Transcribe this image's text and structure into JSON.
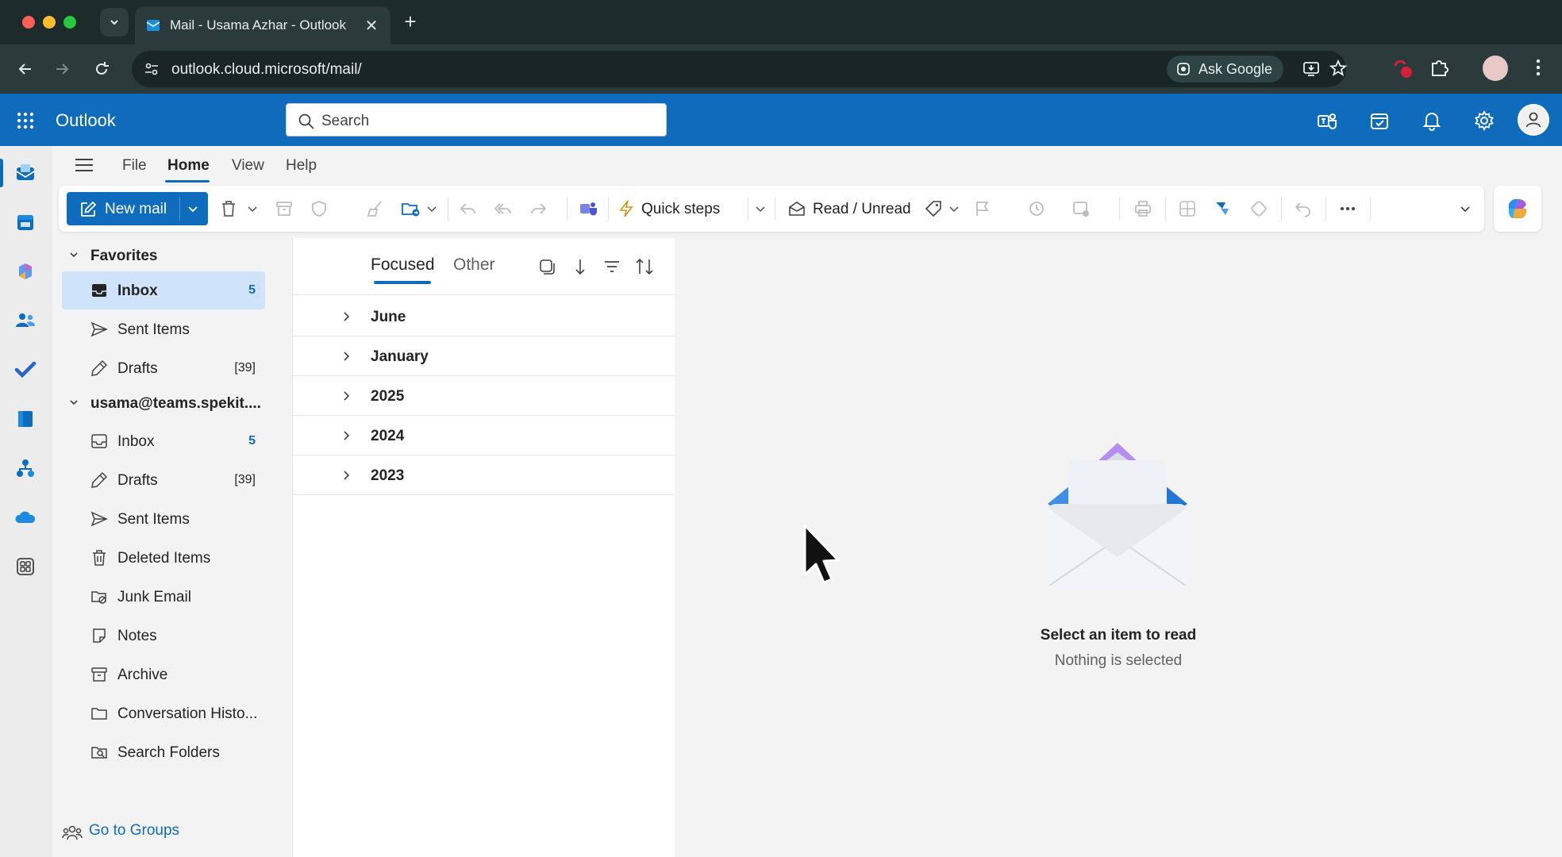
{
  "browser": {
    "tab_title": "Mail - Usama Azhar - Outlook",
    "url": "outlook.cloud.microsoft/mail/",
    "ask_google_label": "Ask Google"
  },
  "header": {
    "app_name": "Outlook",
    "search_placeholder": "Search"
  },
  "menu": {
    "tabs": [
      "File",
      "Home",
      "View",
      "Help"
    ],
    "active": "Home"
  },
  "ribbon": {
    "new_mail_label": "New mail",
    "quick_steps_label": "Quick steps",
    "read_unread_label": "Read / Unread"
  },
  "folders": {
    "favorites_label": "Favorites",
    "favorites": [
      {
        "label": "Inbox",
        "count": "5",
        "icon": "inbox-icon",
        "selected": true
      },
      {
        "label": "Sent Items",
        "count": "",
        "icon": "send-icon"
      },
      {
        "label": "Drafts",
        "count": "[39]",
        "icon": "drafts-icon"
      }
    ],
    "account_label": "usama@teams.spekit....",
    "account_folders": [
      {
        "label": "Inbox",
        "count": "5",
        "icon": "inbox-icon"
      },
      {
        "label": "Drafts",
        "count": "[39]",
        "icon": "drafts-icon"
      },
      {
        "label": "Sent Items",
        "count": "",
        "icon": "send-icon"
      },
      {
        "label": "Deleted Items",
        "count": "",
        "icon": "trash-icon"
      },
      {
        "label": "Junk Email",
        "count": "",
        "icon": "junk-icon"
      },
      {
        "label": "Notes",
        "count": "",
        "icon": "notes-icon"
      },
      {
        "label": "Archive",
        "count": "",
        "icon": "archive-icon"
      },
      {
        "label": "Conversation Histo...",
        "count": "",
        "icon": "folder-icon"
      },
      {
        "label": "Search Folders",
        "count": "",
        "icon": "search-folder-icon"
      }
    ],
    "go_to_groups_label": "Go to Groups"
  },
  "message_list": {
    "pivots": [
      "Focused",
      "Other"
    ],
    "active_pivot": "Focused",
    "groups": [
      "June",
      "January",
      "2025",
      "2024",
      "2023"
    ]
  },
  "reading_pane": {
    "title": "Select an item to read",
    "subtitle": "Nothing is selected"
  },
  "colors": {
    "brand_blue": "#0f6cbd",
    "selected_folder": "#cfe4fa",
    "chrome_dark": "#1e2b2b"
  }
}
